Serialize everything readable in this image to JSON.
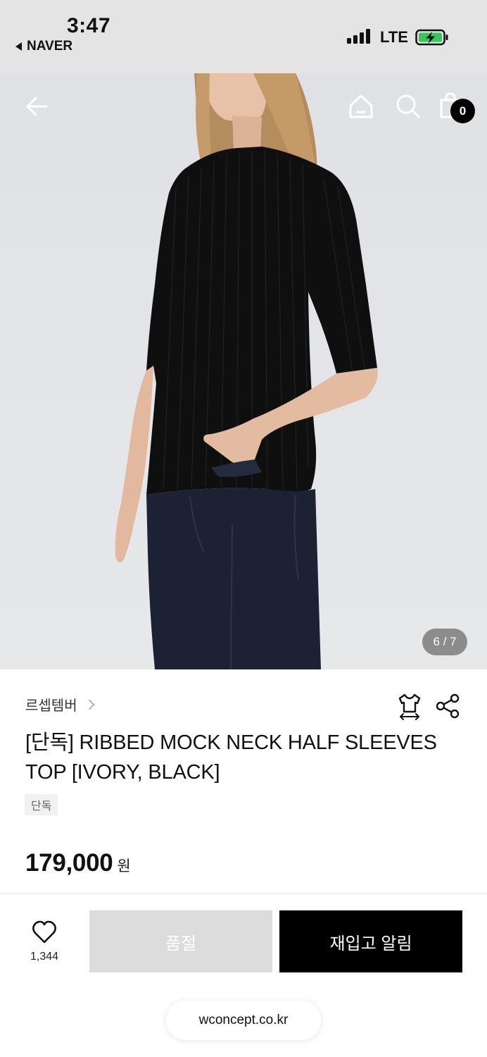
{
  "status_bar": {
    "time": "3:47",
    "back_app": "NAVER",
    "network": "LTE",
    "battery_color": "#34c759"
  },
  "nav": {
    "back_icon": "arrow-left-icon",
    "home_icon": "home-icon",
    "search_icon": "search-icon",
    "cart_icon": "shopping-bag-icon",
    "cart_count": "0"
  },
  "gallery": {
    "indicator": "6 / 7"
  },
  "product": {
    "brand": "르셉템버",
    "title": "[단독] RIBBED MOCK NECK HALF SLEEVES TOP [IVORY, BLACK]",
    "tag": "단독",
    "price": "179,000",
    "currency": "원",
    "size_icon": "size-guide-shirt-icon",
    "share_icon": "share-icon"
  },
  "actions": {
    "like_icon": "heart-icon",
    "like_count": "1,344",
    "sold_out_label": "품절",
    "restock_label": "재입고 알림"
  },
  "browser": {
    "url": "wconcept.co.kr"
  }
}
